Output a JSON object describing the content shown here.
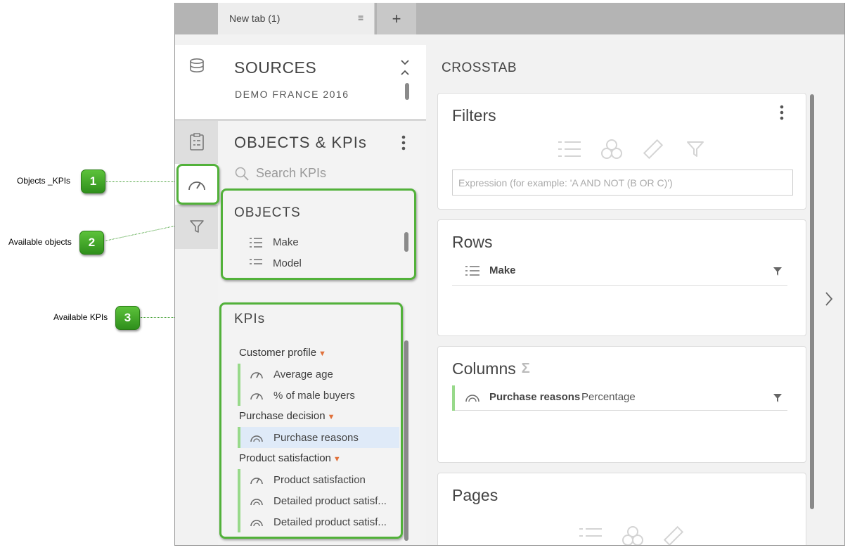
{
  "callouts": [
    {
      "number": "1",
      "label": "Objects _KPIs"
    },
    {
      "number": "2",
      "label": "Available objects"
    },
    {
      "number": "3",
      "label": "Available KPIs"
    }
  ],
  "tabs": {
    "active_label": "New tab (1)",
    "menu_glyph": "≡",
    "add_glyph": "+"
  },
  "sources": {
    "title": "SOURCES",
    "subtitle": "DEMO FRANCE 2016"
  },
  "objects_panel": {
    "title": "OBJECTS & KPIs",
    "search_placeholder": "Search KPIs",
    "objects_title": "OBJECTS",
    "objects": [
      "Make",
      "Model"
    ],
    "kpis_title": "KPIs",
    "kpi_groups": [
      {
        "name": "Customer profile",
        "items": [
          "Average age",
          "% of male buyers"
        ]
      },
      {
        "name": "Purchase decision",
        "items": [
          "Purchase reasons"
        ]
      },
      {
        "name": "Product satisfaction",
        "items": [
          "Product satisfaction",
          "Detailed product satisf...",
          "Detailed product satisf..."
        ]
      }
    ]
  },
  "crosstab": {
    "title": "CROSSTAB",
    "filters": {
      "title": "Filters",
      "expression_placeholder": "Expression (for example: 'A AND NOT (B OR C)')"
    },
    "rows": {
      "title": "Rows",
      "items": [
        {
          "name": "Make"
        }
      ]
    },
    "columns": {
      "title": "Columns",
      "sigma": "Σ",
      "items": [
        {
          "name": "Purchase reasons",
          "detail": "Percentage"
        }
      ]
    },
    "pages": {
      "title": "Pages"
    }
  },
  "colors": {
    "highlight_green": "#52b13a",
    "kpi_bar": "#98d98a",
    "caret_orange": "#e0703a",
    "selected_row": "#dfeaf8"
  }
}
